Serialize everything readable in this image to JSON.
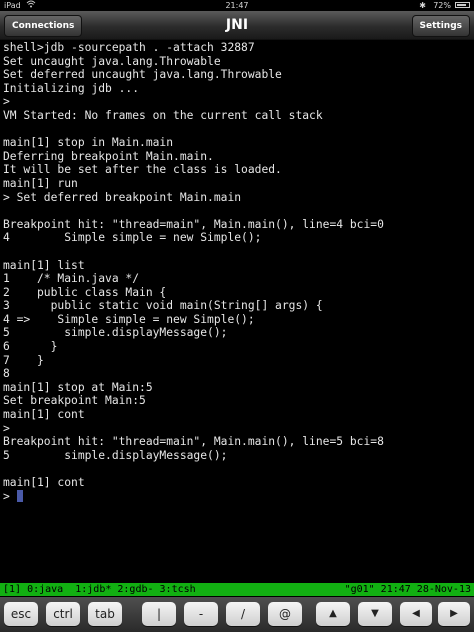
{
  "status_bar": {
    "carrier": "iPad",
    "wifi_icon": "wifi-icon",
    "time": "21:47",
    "bluetooth_icon": "bluetooth-icon",
    "battery_percent": "72%",
    "battery_icon": "battery-icon"
  },
  "nav": {
    "left_button": "Connections",
    "title": "JNI",
    "right_button": "Settings"
  },
  "terminal": {
    "lines": [
      "shell>jdb -sourcepath . -attach 32887",
      "Set uncaught java.lang.Throwable",
      "Set deferred uncaught java.lang.Throwable",
      "Initializing jdb ...",
      ">",
      "VM Started: No frames on the current call stack",
      "",
      "main[1] stop in Main.main",
      "Deferring breakpoint Main.main.",
      "It will be set after the class is loaded.",
      "main[1] run",
      "> Set deferred breakpoint Main.main",
      "",
      "Breakpoint hit: \"thread=main\", Main.main(), line=4 bci=0",
      "4        Simple simple = new Simple();",
      "",
      "main[1] list",
      "1    /* Main.java */",
      "2    public class Main {",
      "3      public static void main(String[] args) {",
      "4 =>    Simple simple = new Simple();",
      "5        simple.displayMessage();",
      "6      }",
      "7    }",
      "8",
      "main[1] stop at Main:5",
      "Set breakpoint Main:5",
      "main[1] cont",
      ">",
      "Breakpoint hit: \"thread=main\", Main.main(), line=5 bci=8",
      "5        simple.displayMessage();",
      "",
      "main[1] cont"
    ],
    "prompt": "> "
  },
  "tmux": {
    "left": "[1] 0:java  1:jdb* 2:gdb- 3:tcsh",
    "right": "\"g01\" 21:47 28-Nov-13"
  },
  "keys": {
    "esc": "esc",
    "ctrl": "ctrl",
    "tab": "tab",
    "pipe": "|",
    "dash": "-",
    "slash": "/",
    "at": "@",
    "up": "▲",
    "down": "▼",
    "left": "◀",
    "right": "▶"
  }
}
